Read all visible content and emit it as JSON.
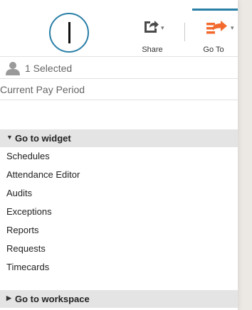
{
  "toolbar": {
    "share_label": "Share",
    "share_icon": "share-export-icon",
    "goto_label": "Go To",
    "goto_icon": "goto-arrow-icon",
    "accent_color": "#2a7fa6",
    "goto_icon_color": "#f26a2e"
  },
  "selection": {
    "icon": "person-icon",
    "text": "1 Selected"
  },
  "timeframe": {
    "text": "Current Pay Period"
  },
  "widget_section": {
    "title": "Go to widget",
    "expanded": true,
    "items": [
      "Schedules",
      "Attendance Editor",
      "Audits",
      "Exceptions",
      "Reports",
      "Requests",
      "Timecards"
    ]
  },
  "workspace_section": {
    "title": "Go to workspace",
    "expanded": false
  }
}
